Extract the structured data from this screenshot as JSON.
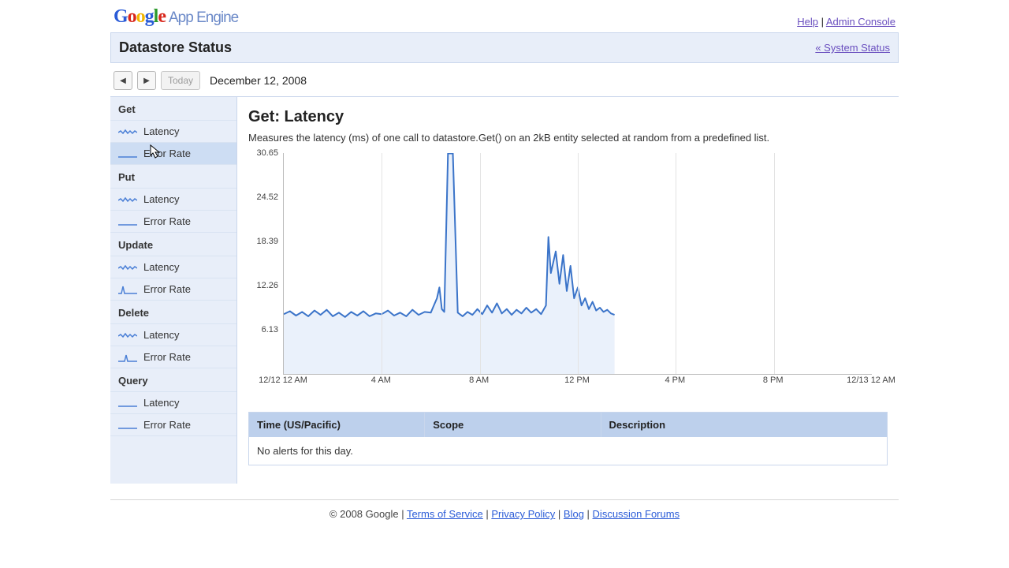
{
  "brand": {
    "appengine": "App Engine"
  },
  "toplinks": {
    "help": "Help",
    "admin": "Admin Console"
  },
  "statusbar": {
    "title": "Datastore Status",
    "back_label": "« System Status"
  },
  "datebar": {
    "prev": "◀",
    "next": "▶",
    "today": "Today",
    "date": "December 12, 2008"
  },
  "sidebar": {
    "groups": [
      {
        "title": "Get",
        "items": [
          {
            "label": "Latency",
            "spark": "wavy"
          },
          {
            "label": "Error Rate",
            "spark": "flat",
            "selected": true
          }
        ]
      },
      {
        "title": "Put",
        "items": [
          {
            "label": "Latency",
            "spark": "wavy"
          },
          {
            "label": "Error Rate",
            "spark": "flat"
          }
        ]
      },
      {
        "title": "Update",
        "items": [
          {
            "label": "Latency",
            "spark": "wavy"
          },
          {
            "label": "Error Rate",
            "spark": "spike"
          }
        ]
      },
      {
        "title": "Delete",
        "items": [
          {
            "label": "Latency",
            "spark": "wavy"
          },
          {
            "label": "Error Rate",
            "spark": "spike2"
          }
        ]
      },
      {
        "title": "Query",
        "items": [
          {
            "label": "Latency",
            "spark": "flat"
          },
          {
            "label": "Error Rate",
            "spark": "flat"
          }
        ]
      }
    ]
  },
  "main": {
    "heading": "Get: Latency",
    "description": "Measures the latency (ms) of one call to datastore.Get() on an 2kB entity selected at random from a predefined list."
  },
  "alerts": {
    "cols": {
      "time": "Time (US/Pacific)",
      "scope": "Scope",
      "desc": "Description"
    },
    "empty": "No alerts for this day."
  },
  "footer": {
    "copyright": "© 2008 Google",
    "links": {
      "tos": "Terms of Service",
      "privacy": "Privacy Policy",
      "blog": "Blog",
      "forums": "Discussion Forums"
    }
  },
  "chart_data": {
    "type": "line",
    "title": "Get: Latency",
    "xlabel": "",
    "ylabel": "",
    "ylim": [
      0,
      30.65
    ],
    "y_ticks": [
      6.13,
      12.26,
      18.39,
      24.52,
      30.65
    ],
    "x_tick_labels": [
      "12/12 12 AM",
      "4 AM",
      "8 AM",
      "12 PM",
      "4 PM",
      "8 PM",
      "12/13 12 AM"
    ],
    "x_tick_positions_hours": [
      0,
      4,
      8,
      12,
      16,
      20,
      24
    ],
    "x_range_hours": [
      0,
      24
    ],
    "data_end_hour": 13.5,
    "series": [
      {
        "name": "Latency (ms)",
        "x_hours": [
          0.0,
          0.25,
          0.5,
          0.75,
          1.0,
          1.25,
          1.5,
          1.75,
          2.0,
          2.25,
          2.5,
          2.75,
          3.0,
          3.25,
          3.5,
          3.75,
          4.0,
          4.25,
          4.5,
          4.75,
          5.0,
          5.25,
          5.5,
          5.75,
          6.0,
          6.1,
          6.25,
          6.35,
          6.45,
          6.55,
          6.7,
          6.9,
          7.1,
          7.3,
          7.5,
          7.7,
          7.9,
          8.1,
          8.3,
          8.5,
          8.7,
          8.9,
          9.1,
          9.3,
          9.5,
          9.7,
          9.9,
          10.1,
          10.3,
          10.5,
          10.7,
          10.8,
          10.9,
          11.1,
          11.25,
          11.4,
          11.55,
          11.7,
          11.85,
          12.0,
          12.15,
          12.3,
          12.45,
          12.6,
          12.75,
          12.9,
          13.05,
          13.2,
          13.35,
          13.5
        ],
        "values": [
          8.3,
          8.7,
          8.1,
          8.6,
          8.0,
          8.8,
          8.2,
          8.9,
          8.0,
          8.5,
          7.9,
          8.6,
          8.1,
          8.7,
          8.0,
          8.4,
          8.3,
          8.8,
          8.1,
          8.5,
          8.0,
          8.9,
          8.2,
          8.6,
          8.5,
          9.3,
          10.5,
          12.0,
          9.0,
          8.6,
          30.6,
          30.6,
          8.5,
          8.0,
          8.6,
          8.2,
          9.0,
          8.3,
          9.5,
          8.5,
          9.8,
          8.4,
          9.0,
          8.2,
          8.9,
          8.4,
          9.2,
          8.5,
          9.0,
          8.3,
          9.5,
          19.0,
          14.0,
          17.0,
          12.5,
          16.5,
          11.5,
          15.0,
          10.5,
          12.0,
          9.5,
          10.5,
          9.0,
          10.0,
          8.8,
          9.2,
          8.6,
          8.9,
          8.4,
          8.2
        ]
      }
    ]
  }
}
